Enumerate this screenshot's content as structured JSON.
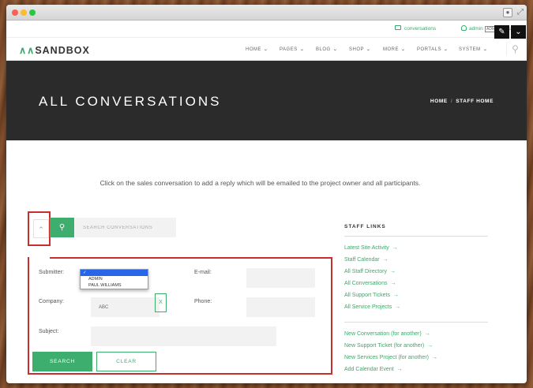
{
  "browser": {
    "user_icon": "user-icon",
    "expand_icon": "expand-icon"
  },
  "topbar": {
    "conversations": "conversations",
    "admin": "admin",
    "badge": "ADMIN",
    "logout": "logout"
  },
  "fab": {
    "edit": "✎",
    "menu": "⌄"
  },
  "logo": {
    "mark": "∧∧",
    "text": "SANDBOX"
  },
  "nav": [
    {
      "label": "HOME"
    },
    {
      "label": "PAGES"
    },
    {
      "label": "BLOG"
    },
    {
      "label": "SHOP"
    },
    {
      "label": "MORE"
    },
    {
      "label": "PORTALS"
    },
    {
      "label": "SYSTEM"
    }
  ],
  "hero": {
    "title": "ALL CONVERSATIONS",
    "crumb_home": "HOME",
    "crumb_sep": "/",
    "crumb_current": "STAFF HOME"
  },
  "intro": "Click on the sales conversation to add a reply which will be emailed to the project owner and all participants.",
  "search": {
    "placeholder": "SEARCH CONVERSATIONS"
  },
  "form": {
    "submitter_label": "Submitter:",
    "email_label": "E-mail:",
    "company_label": "Company:",
    "company_value": "ABC",
    "clear_x": "X",
    "phone_label": "Phone:",
    "subject_label": "Subject:",
    "dropdown": {
      "selected": "✓",
      "options": [
        "ADMIN",
        "PAUL WILLIAMS"
      ]
    },
    "search_button": "SEARCH",
    "clear_button": "CLEAR"
  },
  "sidebar": {
    "title": "STAFF LINKS",
    "group1": [
      "Latest Site Activity",
      "Staff Calendar",
      "All Staff Directory",
      "All Conversations",
      "All Support Tickets",
      "All Service Projects"
    ],
    "group2": [
      "New Conversation (for another)",
      "New Support Ticket (for another)",
      "New Services Project (for another)",
      "Add Calendar Event"
    ]
  },
  "colors": {
    "accent": "#3dae6d",
    "hero_bg": "#2b2b2b",
    "highlight": "#c72e2e"
  }
}
